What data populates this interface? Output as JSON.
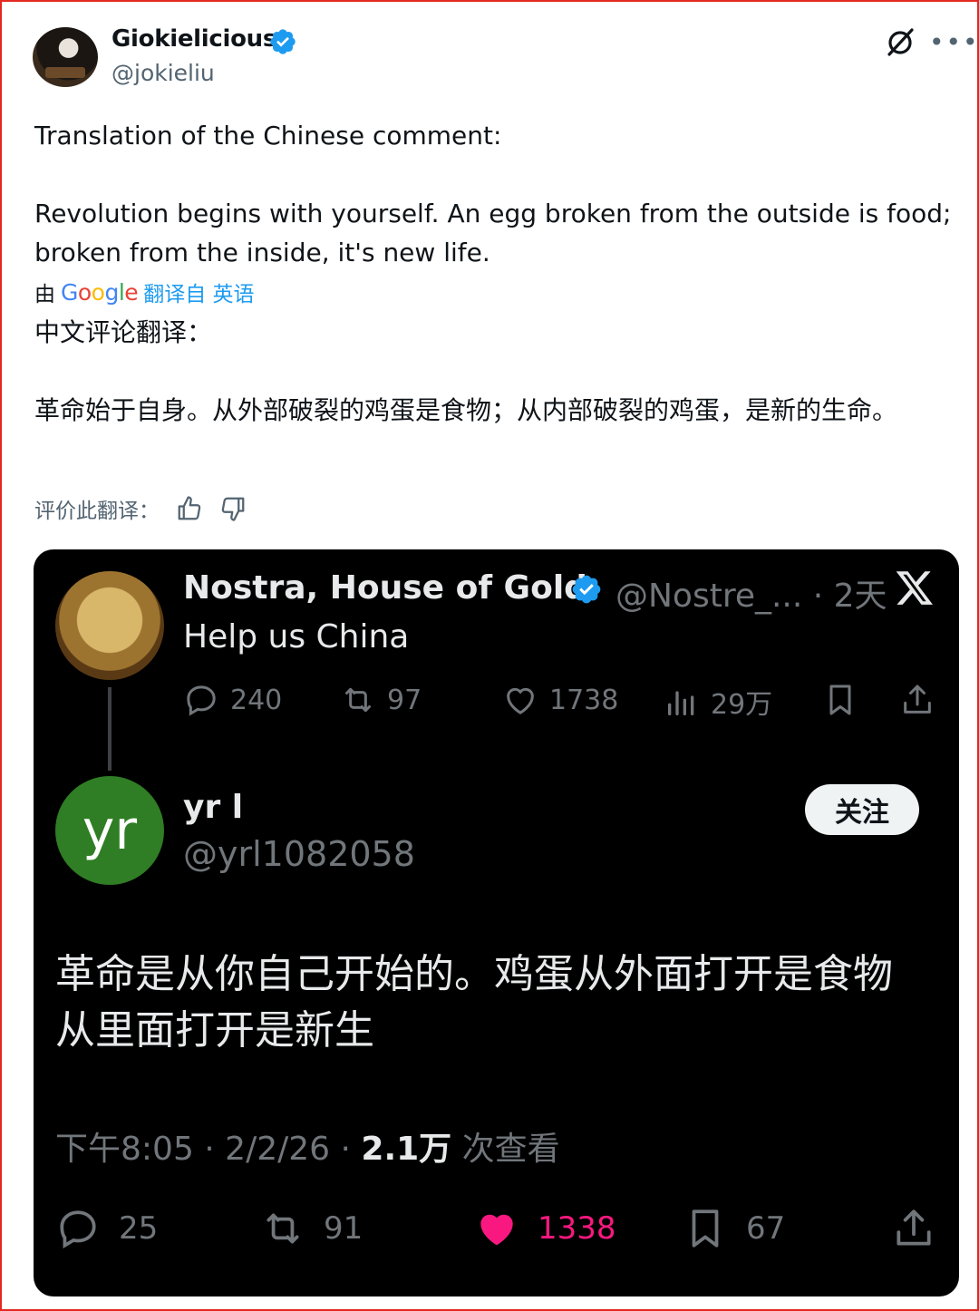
{
  "author": {
    "name": "Giokielicious",
    "handle": "@jokieliu"
  },
  "post": {
    "text_en_1": "Translation of the Chinese comment:",
    "text_en_2": "Revolution begins with yourself. An egg broken from the outside is food; broken from the inside, it's new life.",
    "translated_by_prefix": "由",
    "translated_by_brand": "Google",
    "translated_from": "翻译自 英语",
    "text_cn_1": "中文评论翻译：",
    "text_cn_2": "革命始于自身。从外部破裂的鸡蛋是食物；从内部破裂的鸡蛋，是新的生命。",
    "rate_label": "评价此翻译："
  },
  "quoted": {
    "parent": {
      "name": "Nostra, House of Gold",
      "handle_time": "@Nostre_... · 2天",
      "text": "Help us China",
      "stats": {
        "replies": "240",
        "reposts": "97",
        "likes": "1738",
        "views": "29万"
      }
    },
    "reply": {
      "avatar_text": "yr",
      "name": "yr l",
      "handle": "@yrl1082058",
      "follow_label": "关注",
      "text_1": "革命是从你自己开始的。鸡蛋从外面打开是食物",
      "text_2": "从里面打开是新生",
      "meta_time": "下午8:05 · 2/2/26 · ",
      "meta_views": "2.1万",
      "meta_views_suffix": " 次查看",
      "stats": {
        "replies": "25",
        "reposts": "91",
        "likes": "1338",
        "bookmarks": "67"
      }
    }
  },
  "colors": {
    "accent": "#1d9bf0",
    "like": "#f91880",
    "card_bg": "#000000",
    "border": "#e4281f"
  }
}
